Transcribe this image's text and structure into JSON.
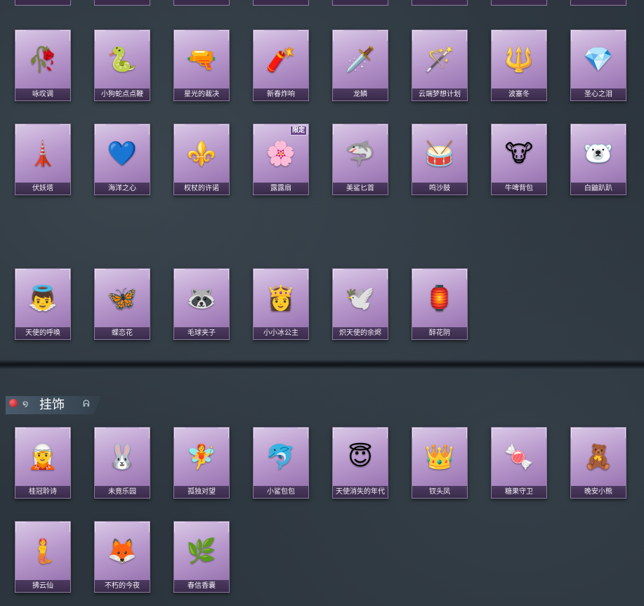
{
  "section_title": "挂饰",
  "badges": {
    "limited": "限定"
  },
  "row1": [
    {
      "name": "咏叹调",
      "icon": "🥀"
    },
    {
      "name": "小狗蛇点点鞭",
      "icon": "🐍"
    },
    {
      "name": "星光的裁决",
      "icon": "🔫"
    },
    {
      "name": "新春炸响",
      "icon": "🧨"
    },
    {
      "name": "龙鳞",
      "icon": "🗡️"
    },
    {
      "name": "云端梦想计划",
      "icon": "🪄"
    },
    {
      "name": "波塞冬",
      "icon": "🔱"
    },
    {
      "name": "圣心之泪",
      "icon": "💎"
    }
  ],
  "row2": [
    {
      "name": "伏妖塔",
      "icon": "🗼"
    },
    {
      "name": "海洋之心",
      "icon": "💙"
    },
    {
      "name": "权杖的许诺",
      "icon": "⚜️"
    },
    {
      "name": "露露扇",
      "icon": "🌸"
    },
    {
      "name": "美鲨匕首",
      "icon": "🦈"
    },
    {
      "name": "鸣沙鼓",
      "icon": "🥁"
    },
    {
      "name": "牛啤背包",
      "icon": "🐮"
    },
    {
      "name": "白鼬趴趴",
      "icon": "🐻‍❄️"
    }
  ],
  "row3": [
    {
      "name": "天使的呼唤",
      "icon": "👼"
    },
    {
      "name": "蝶恋花",
      "icon": "🦋"
    },
    {
      "name": "毛球夹子",
      "icon": "🦝"
    },
    {
      "name": "小小冰公主",
      "icon": "👸"
    },
    {
      "name": "炽天使的余烬",
      "icon": "🕊️"
    },
    {
      "name": "醉花阴",
      "icon": "🏮"
    }
  ],
  "row4": [
    {
      "name": "桂冠聆诗",
      "icon": "🧝"
    },
    {
      "name": "未竟乐园",
      "icon": "🐰"
    },
    {
      "name": "孤独对望",
      "icon": "🧚"
    },
    {
      "name": "小鲨包包",
      "icon": "🐬"
    },
    {
      "name": "天使消失的年代",
      "icon": "😇"
    },
    {
      "name": "钗头凤",
      "icon": "👑"
    },
    {
      "name": "糖果守卫",
      "icon": "🍬"
    },
    {
      "name": "晚安小熊",
      "icon": "🧸"
    }
  ],
  "row5": [
    {
      "name": "拂云仙",
      "icon": "🧜"
    },
    {
      "name": "不朽的今夜",
      "icon": "🦊"
    },
    {
      "name": "春信香囊",
      "icon": "🌿"
    }
  ]
}
